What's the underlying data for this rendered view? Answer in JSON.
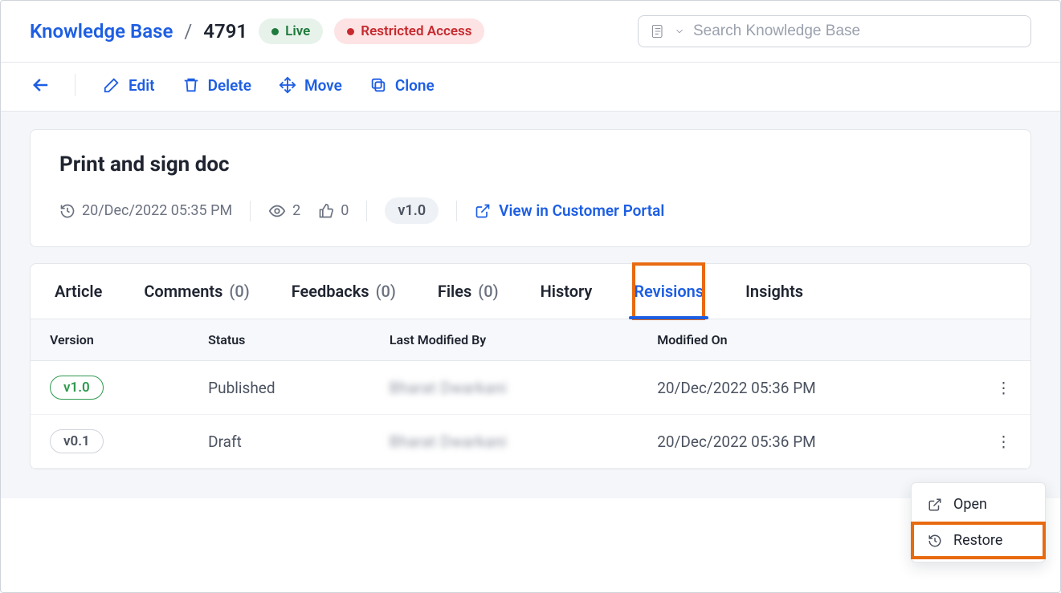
{
  "header": {
    "breadcrumb_root": "Knowledge Base",
    "breadcrumb_id": "4791",
    "status_live": "Live",
    "status_restricted": "Restricted Access",
    "search_placeholder": "Search Knowledge Base"
  },
  "actions": {
    "edit": "Edit",
    "delete": "Delete",
    "move": "Move",
    "clone": "Clone"
  },
  "article": {
    "title": "Print and sign doc",
    "modified": "20/Dec/2022 05:35 PM",
    "views": "2",
    "likes": "0",
    "version": "v1.0",
    "portal_link": "View in Customer Portal"
  },
  "tabs": {
    "article": "Article",
    "comments": "Comments",
    "comments_count": "(0)",
    "feedbacks": "Feedbacks",
    "feedbacks_count": "(0)",
    "files": "Files",
    "files_count": "(0)",
    "history": "History",
    "revisions": "Revisions",
    "insights": "Insights"
  },
  "table": {
    "col_version": "Version",
    "col_status": "Status",
    "col_modified_by": "Last Modified By",
    "col_modified_on": "Modified On",
    "rows": [
      {
        "version": "v1.0",
        "status": "Published",
        "modified_by": "Bharat Dwarkani",
        "modified_on": "20/Dec/2022 05:36 PM",
        "published": true
      },
      {
        "version": "v0.1",
        "status": "Draft",
        "modified_by": "Bharat Dwarkani",
        "modified_on": "20/Dec/2022 05:36 PM",
        "published": false
      }
    ]
  },
  "context_menu": {
    "open": "Open",
    "restore": "Restore"
  }
}
